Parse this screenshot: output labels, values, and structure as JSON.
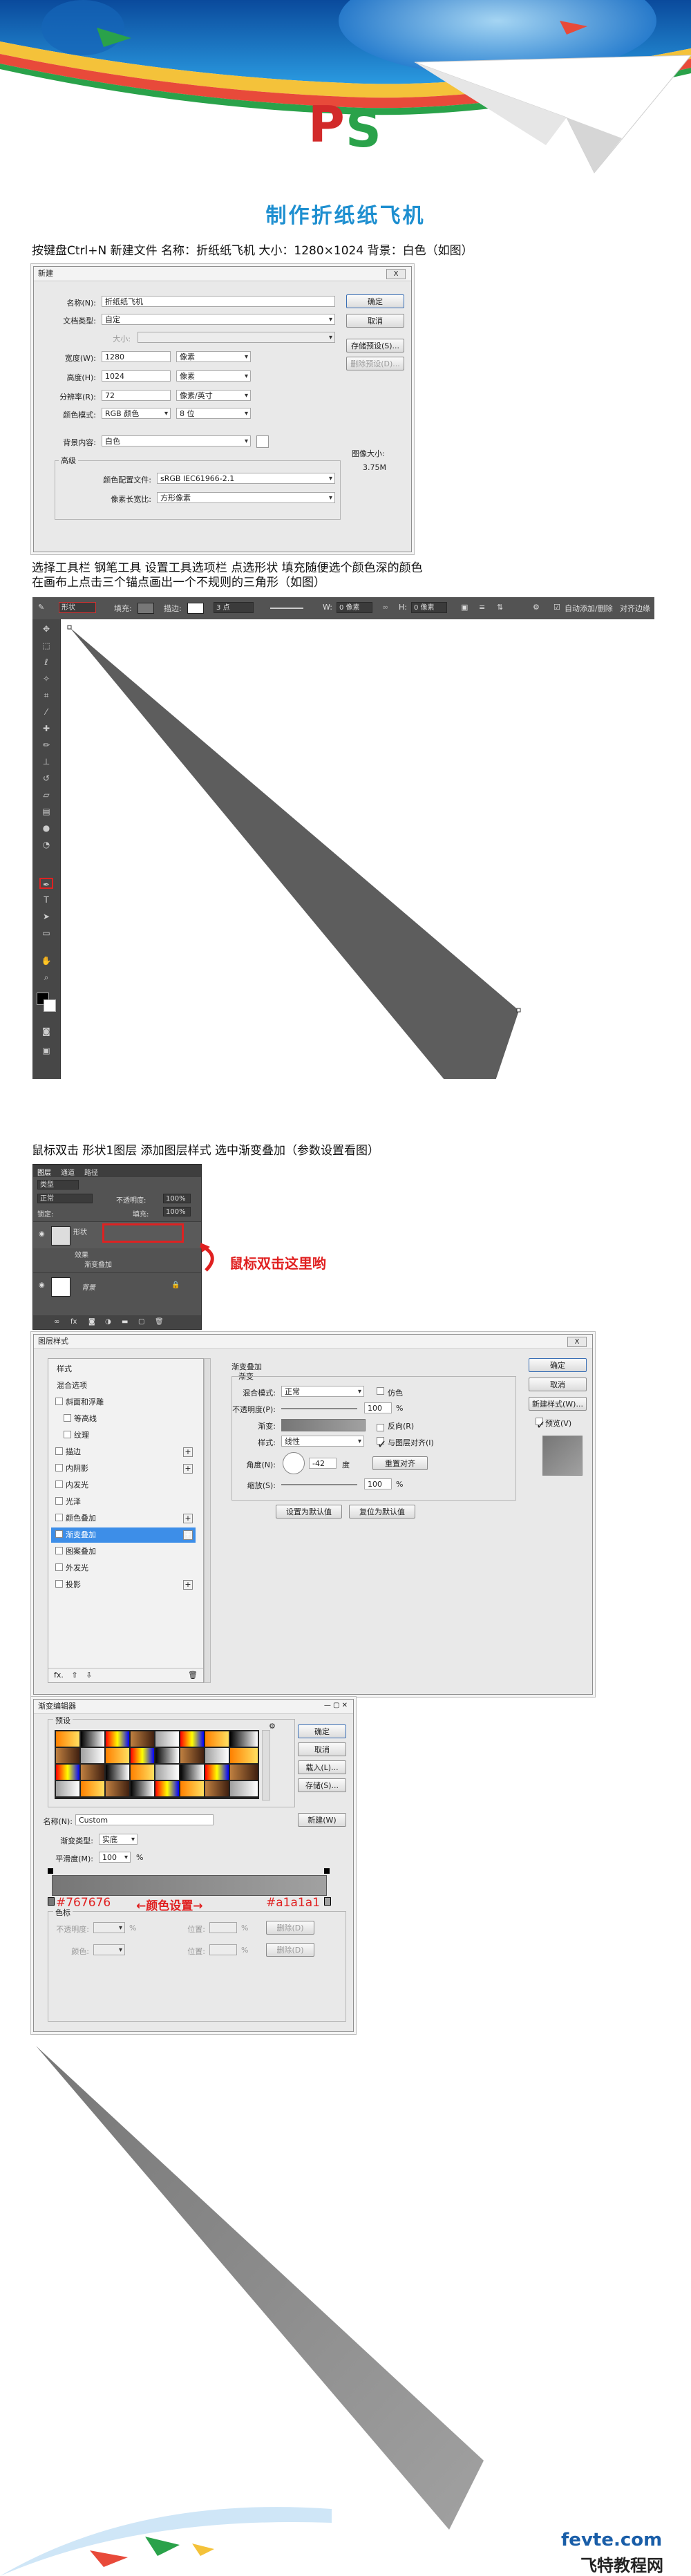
{
  "banner": {
    "logo_text": "PS"
  },
  "title": "制作折纸纸飞机",
  "steps": {
    "s1": "按键盘Ctrl+N 新建文件 名称：折纸纸飞机 大小：1280×1024 背景：白色（如图）",
    "s2_line1": "选择工具栏 钢笔工具 设置工具选项栏 点选形状 填充随便选个颜色深的颜色",
    "s2_line2": "在画布上点击三个锚点画出一个不规则的三角形（如图）",
    "s3": "鼠标双击 形状1图层 添加图层样式 选中渐变叠加（参数设置看图）"
  },
  "new_dialog": {
    "title": "新建",
    "close": "X",
    "name_label": "名称(N):",
    "name_value": "折纸纸飞机",
    "preset_label": "文档类型:",
    "preset_value": "自定",
    "size_label": "大小:",
    "width_label": "宽度(W):",
    "width_value": "1280",
    "width_unit": "像素",
    "height_label": "高度(H):",
    "height_value": "1024",
    "height_unit": "像素",
    "res_label": "分辨率(R):",
    "res_value": "72",
    "res_unit": "像素/英寸",
    "mode_label": "颜色模式:",
    "mode_value": "RGB 颜色",
    "bits_value": "8 位",
    "bg_label": "背景内容:",
    "bg_value": "白色",
    "advanced": "高级",
    "profile_label": "颜色配置文件:",
    "profile_value": "sRGB IEC61966-2.1",
    "pixel_label": "像素长宽比:",
    "pixel_value": "方形像素",
    "ok": "确定",
    "cancel": "取消",
    "save_preset": "存储预设(S)...",
    "delete_preset": "删除预设(D)...",
    "image_size_label": "图像大小:",
    "image_size_value": "3.75M"
  },
  "ps_toolbar": {
    "mode": "形状",
    "fill": "填充:",
    "stroke": "描边:",
    "stroke_size": "3 点",
    "w": "W:",
    "w_val": "0 像素",
    "h": "H:",
    "h_val": "0 像素",
    "auto": "自动添加/删除",
    "align": "对齐边缘"
  },
  "layers": {
    "tabs": [
      "图层",
      "通道",
      "路径"
    ],
    "kind": "类型",
    "blend": "正常",
    "opacity_label": "不透明度:",
    "opacity": "100%",
    "lock_label": "锁定:",
    "fill_label": "填充:",
    "fill": "100%",
    "shape_layer": "形状",
    "effects": "效果",
    "gradient_effect": "渐变叠加",
    "bg_layer": "背景"
  },
  "annotation1": "鼠标双击这里哟",
  "style_dialog": {
    "title": "图层样式",
    "items": [
      {
        "label": "样式",
        "check": false,
        "plus": false
      },
      {
        "label": "混合选项",
        "check": false,
        "plus": false
      },
      {
        "label": "斜面和浮雕",
        "check": true,
        "plus": false
      },
      {
        "label": "等高线",
        "check": true,
        "plus": false,
        "indent": true
      },
      {
        "label": "纹理",
        "check": true,
        "plus": false,
        "indent": true
      },
      {
        "label": "描边",
        "check": true,
        "plus": true
      },
      {
        "label": "内阴影",
        "check": true,
        "plus": true
      },
      {
        "label": "内发光",
        "check": true,
        "plus": false
      },
      {
        "label": "光泽",
        "check": true,
        "plus": false
      },
      {
        "label": "颜色叠加",
        "check": true,
        "plus": true
      },
      {
        "label": "渐变叠加",
        "check": true,
        "plus": true,
        "selected": true
      },
      {
        "label": "图案叠加",
        "check": true,
        "plus": false
      },
      {
        "label": "外发光",
        "check": true,
        "plus": false
      },
      {
        "label": "投影",
        "check": true,
        "plus": true
      }
    ],
    "group": "渐变叠加",
    "sub": "渐变",
    "blend_label": "混合模式:",
    "blend": "正常",
    "dither": "仿色",
    "opacity_label": "不透明度(P):",
    "opacity": "100",
    "gradient_label": "渐变:",
    "reverse": "反向(R)",
    "style_label": "样式:",
    "style": "线性",
    "align": "与图层对齐(I)",
    "angle_label": "角度(N):",
    "angle": "-42",
    "angle_unit": "度",
    "reset_align": "重置对齐",
    "scale_label": "缩放(S):",
    "scale": "100",
    "pct": "%",
    "default_btn": "设置为默认值",
    "reset_btn": "复位为默认值",
    "ok": "确定",
    "cancel": "取消",
    "new_style": "新建样式(W)...",
    "preview": "预览(V)"
  },
  "gradient_editor": {
    "title": "渐变编辑器",
    "presets": "预设",
    "ok": "确定",
    "cancel": "取消",
    "load": "载入(L)...",
    "save": "存储(S)...",
    "name_label": "名称(N):",
    "name": "Custom",
    "new": "新建(W)",
    "type_label": "渐变类型:",
    "type": "实底",
    "smooth_label": "平滑度(M):",
    "smooth": "100",
    "pct": "%",
    "stops": "色标",
    "opacity_label": "不透明度:",
    "color_label": "颜色:",
    "position_label": "位置:",
    "delete": "删除(D)",
    "color_left": "#767676",
    "color_right": "#a1a1a1",
    "arrow_text": "←颜色设置→"
  },
  "watermark": {
    "text1": "fevte.com",
    "text2": "飞特教程网"
  },
  "colors": {
    "accent": "#1e8fd0",
    "dark_shape": "#5d5d5d",
    "grad_start": "#767676",
    "grad_end": "#a1a1a1",
    "red": "#e02020"
  }
}
